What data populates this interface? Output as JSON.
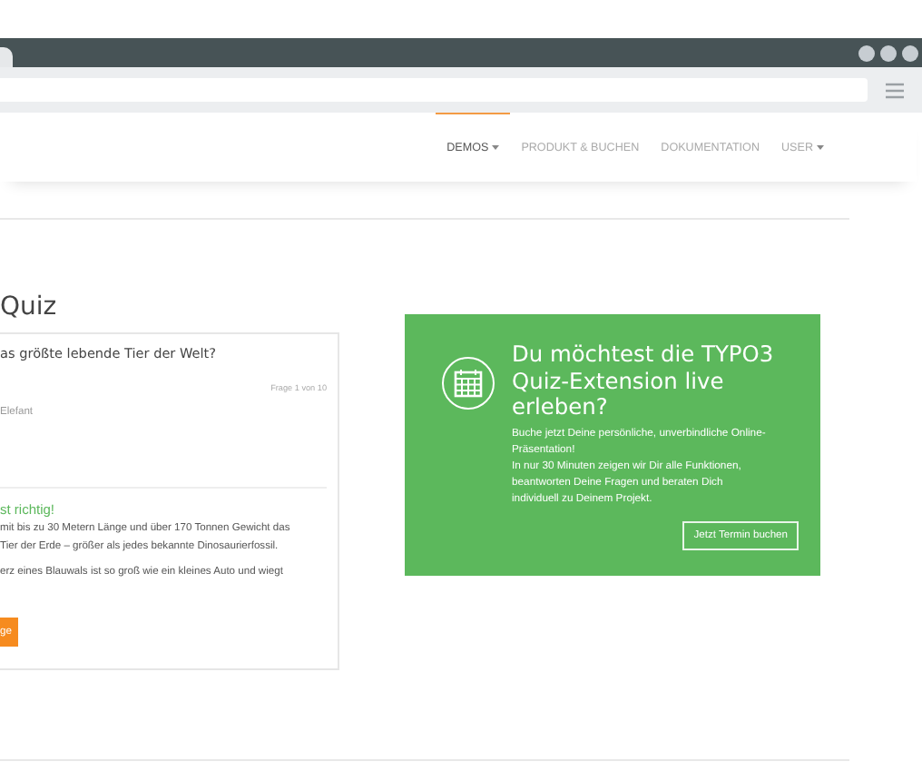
{
  "nav": {
    "items": [
      {
        "label": "DEMOS",
        "dropdown": true,
        "selected": true
      },
      {
        "label": "PRODUKT & BUCHEN",
        "dropdown": false,
        "selected": false
      },
      {
        "label": "DOKUMENTATION",
        "dropdown": false,
        "selected": false
      },
      {
        "label": "USER",
        "dropdown": true,
        "selected": false
      }
    ]
  },
  "heading": "Quiz",
  "quiz": {
    "question": "as größte lebende Tier der Welt?",
    "counter": "Frage 1 von 10",
    "answer": "Elefant",
    "result": "st richtig!",
    "explanation": [
      "mit bis zu 30 Metern Länge und über 170 Tonnen Gewicht das",
      "Tier der Erde – größer als jedes bekannte Dinosaurierfossil."
    ],
    "fact": "erz eines Blauwals ist so groß wie ein kleines Auto und wiegt",
    "button": "ge"
  },
  "promo": {
    "title": "Du möchtest die TYPO3 Quiz-Extension live erleben?",
    "text": [
      "Buche jetzt Deine persönliche, unverbindliche Online-Präsentation!",
      "In nur 30 Minuten zeigen wir Dir alle Funktionen, beantworten Deine Fragen und beraten Dich individuell zu Deinem Projekt."
    ],
    "button": "Jetzt Termin buchen"
  }
}
